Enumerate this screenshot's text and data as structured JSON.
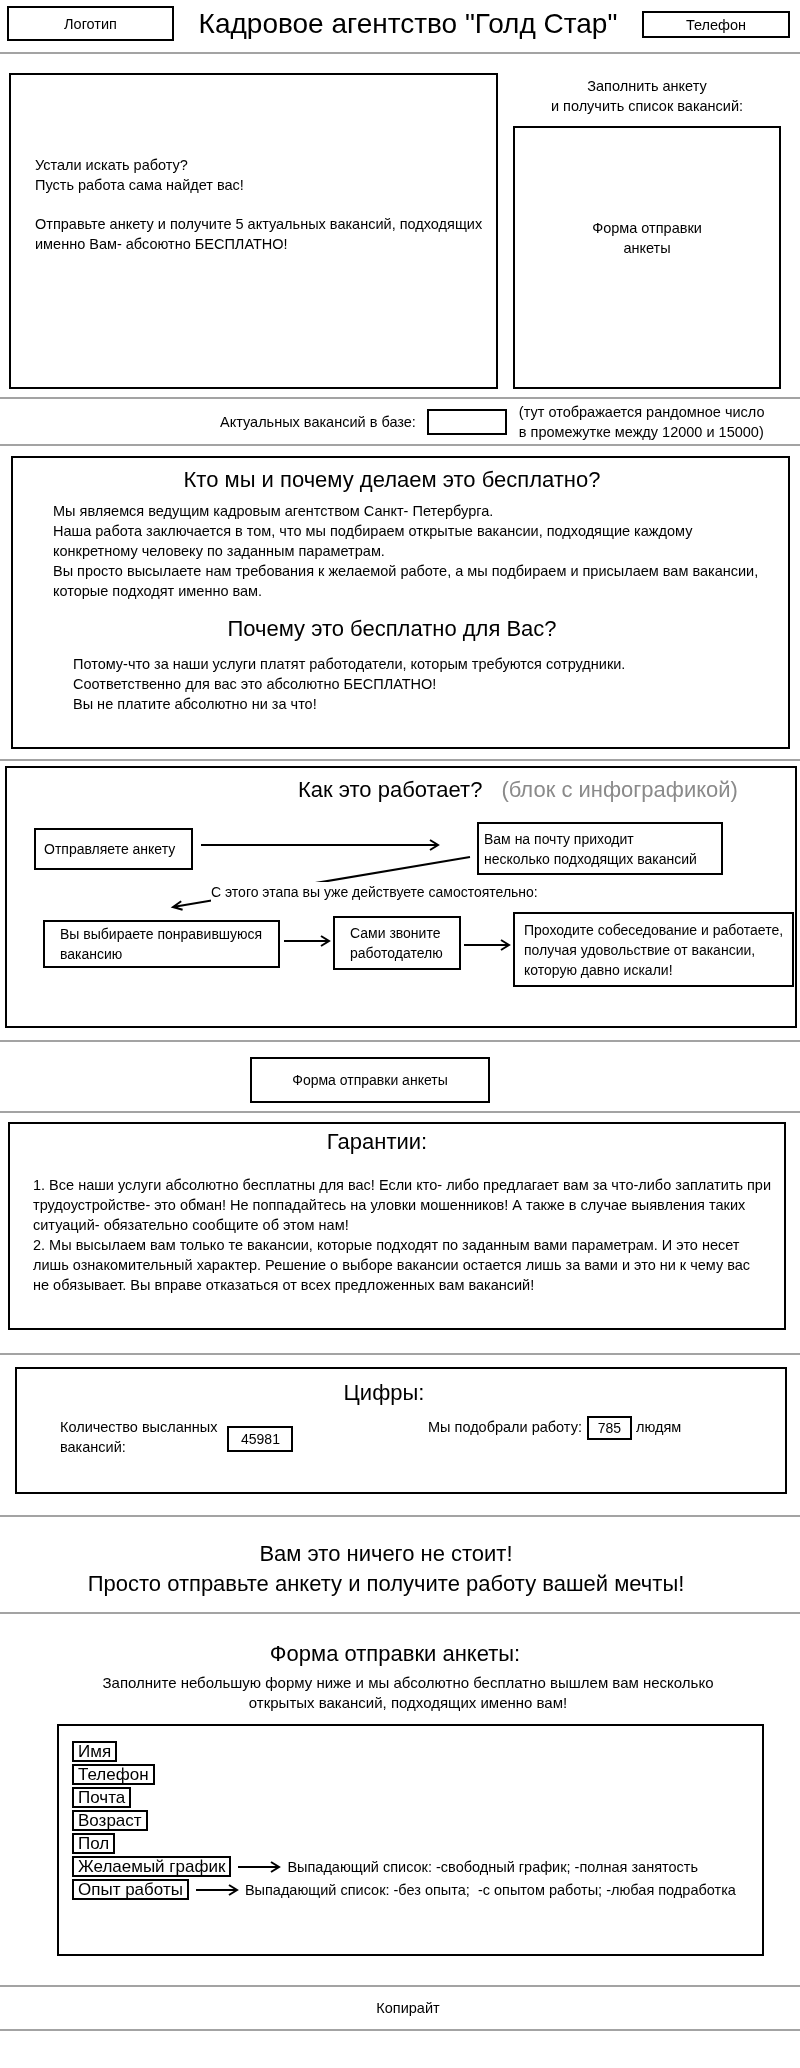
{
  "header": {
    "logo": "Логотип",
    "title": "Кадровое агентство \"Голд Стар\"",
    "phone": "Телефон"
  },
  "hero": {
    "paragraphs": [
      "Устали искать работу?\nПусть работа сама найдет вас!",
      "Отправьте анкету и получите 5 актуальных вакансий, подходящих\nименно Вам- абсоютно БЕСПЛАТНО!"
    ],
    "form_caption": "Заполнить анкету\nи получить список вакансий:",
    "form_block": "Форма отправки\nанкеты"
  },
  "vacancy_counter": {
    "label": "Актуальных вакансий в базе:",
    "note": "(тут отображается рандомное число\nв промежутке между 12000 и 15000)"
  },
  "about": {
    "title": "Кто мы и почему делаем это бесплатно?",
    "text": "Мы являемся ведущим кадровым агентством Санкт- Петербурга.\nНаша работа заключается в том, что мы подбираем открытые вакансии, подходящие каждому\nконкретному человеку по заданным параметрам.\nВы просто высылаете нам требования к желаемой работе, а мы подбираем и присылаем вам вакансии,\nкоторые подходят именно вам.",
    "subtitle": "Почему это бесплатно для Вас?",
    "subtext": "Потому-что за наши услуги платят работодатели, которым требуются сотрудники.\nСоответственно для вас это абсолютно БЕСПЛАТНО!\nВы не платите абсолютно ни за что!"
  },
  "how_it_works": {
    "title": "Как это работает?",
    "comment": "(блок с инфографикой)",
    "steps": [
      "Отправляете анкету",
      "Вам на почту приходит\nнесколько подходящих вакансий",
      "Вы выбираете понравившуюся\nвакансию",
      "Сами звоните\nработодателю",
      "Проходите собеседование и работаете,\nполучая удовольствие от вакансии,\nкоторую давно искали!"
    ],
    "note": "С этого этапа вы уже действуете самостоятельно:"
  },
  "form_button": "Форма отправки анкеты",
  "guarantees": {
    "title": "Гарантии:",
    "items": [
      "1. Все наши услуги абсолютно бесплатны для вас! Если кто- либо предлагает вам за что-либо заплатить при\nтрудоустройстве- это обман! Не поппадайтесь на уловки мошенников! А также в случае выявления таких\nситуаций- обязательно сообщите об этом нам!",
      "2. Мы высылаем вам только те вакансии, которые подходят по заданным вами параметрам. И это несет\nлишь ознакомительный характер. Решение о выборе вакансии остается лишь за вами и это ни к чему вас\nне обязывает. Вы вправе отказаться от всех предложенных вам вакансий!"
    ]
  },
  "numbers": {
    "title": "Цифры:",
    "stats": [
      {
        "label": "Количество высланных\nвакансий:",
        "value": "45981"
      },
      {
        "label": "Мы подобрали работу:",
        "value": "785",
        "suffix": "людям"
      }
    ]
  },
  "cta": "Вам это ничего не стоит!\nПросто отправьте анкету и получите работу вашей мечты!",
  "application_form": {
    "title": "Форма отправки анкеты:",
    "intro": "Заполните небольшую форму ниже и мы абсолютно бесплатно вышлем вам несколько\nоткрытых вакансий, подходящих именно вам!",
    "fields": [
      {
        "kind": "text",
        "placeholder": "Имя"
      },
      {
        "kind": "text",
        "placeholder": "Телефон"
      },
      {
        "kind": "text",
        "placeholder": "Почта"
      },
      {
        "kind": "text",
        "placeholder": "Возраст"
      },
      {
        "kind": "text",
        "placeholder": "Пол"
      },
      {
        "kind": "select",
        "placeholder": "Желаемый график",
        "note": "Выпадающий список: -свободный график; -полная занятость"
      },
      {
        "kind": "select",
        "placeholder": "Опыт работы",
        "note": "Выпадающий список: -без опыта;  -с опытом работы; -любая подработка"
      }
    ]
  },
  "footer": "Копирайт"
}
